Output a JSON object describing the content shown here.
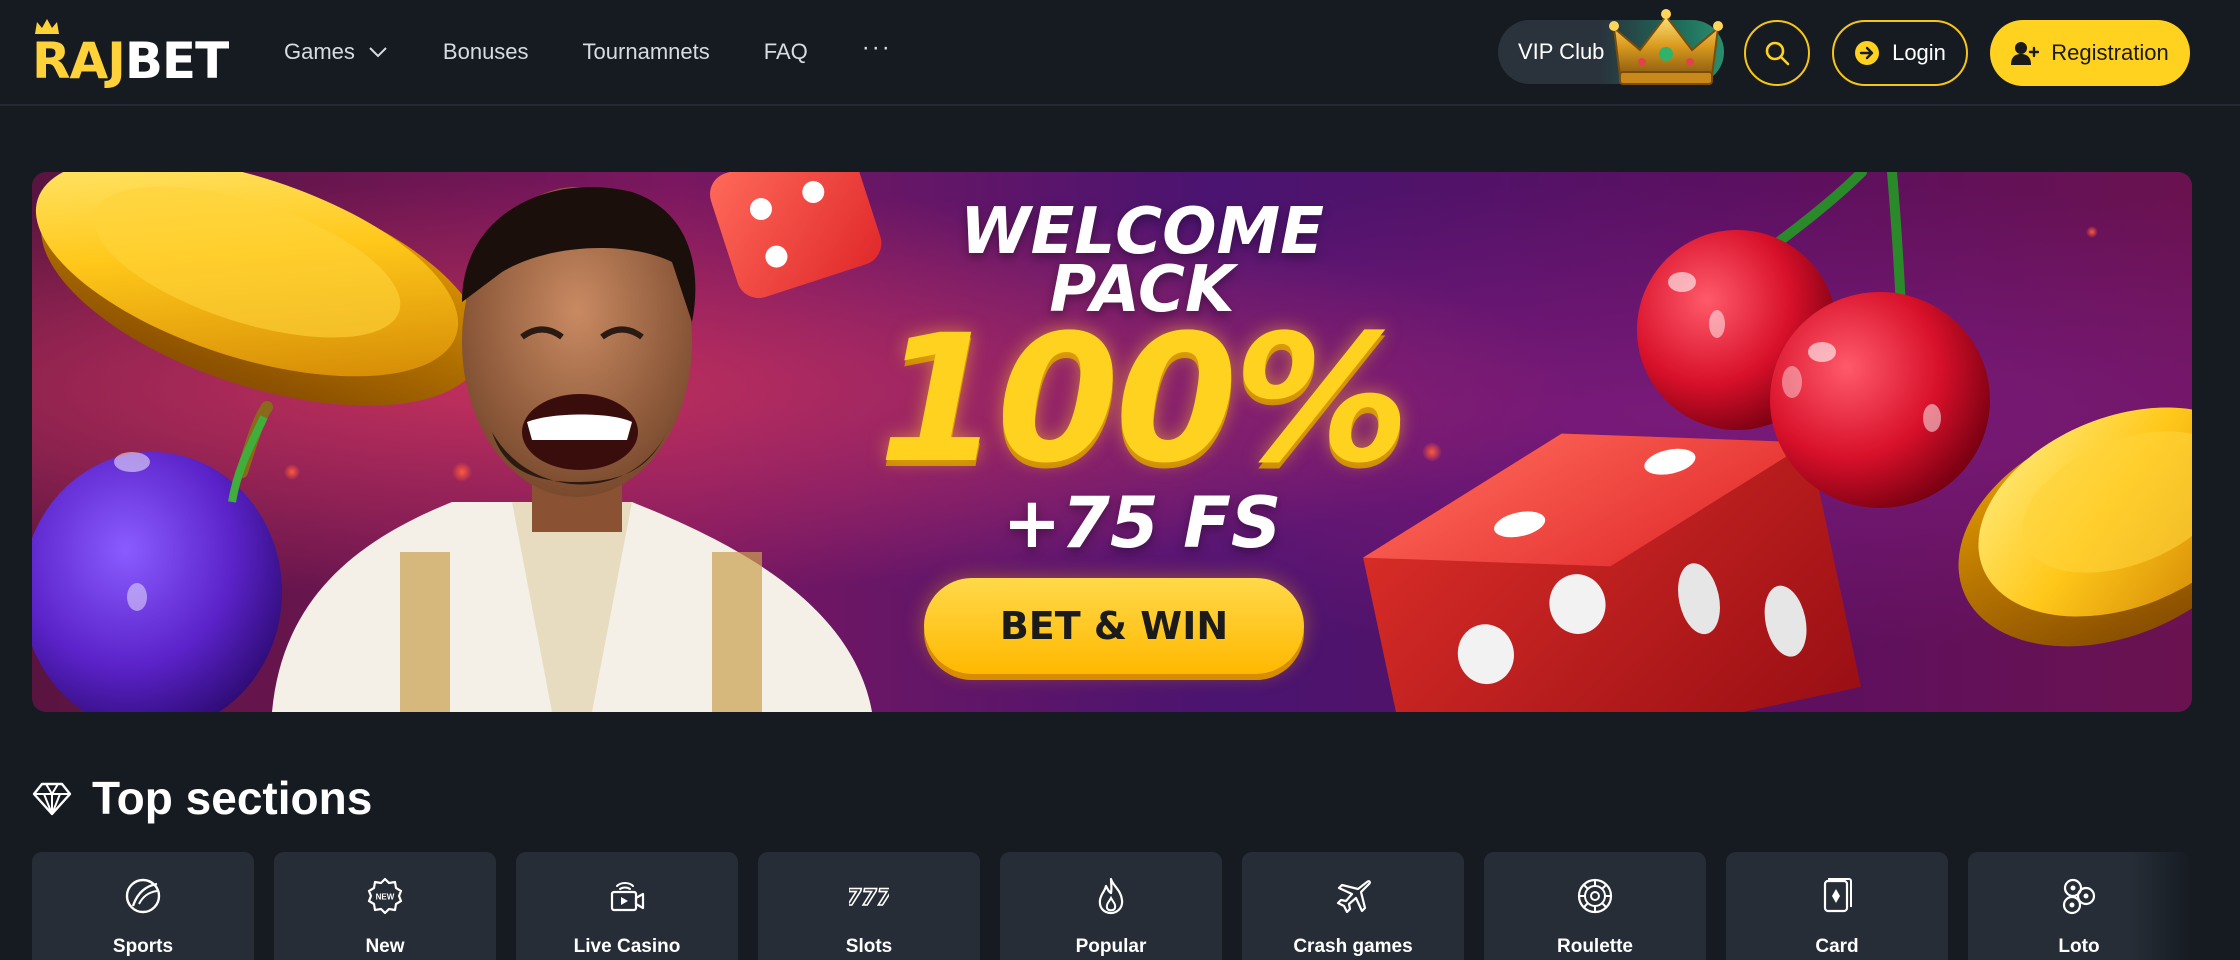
{
  "brand": {
    "part1": "RAJ",
    "part2": "BET",
    "accent": "#ffd21f"
  },
  "nav": [
    {
      "label": "Games",
      "has_dropdown": true
    },
    {
      "label": "Bonuses"
    },
    {
      "label": "Tournamnets"
    },
    {
      "label": "FAQ"
    }
  ],
  "nav_more": "···",
  "header": {
    "vip_label": "VIP Club",
    "login_label": "Login",
    "register_label": "Registration"
  },
  "banner": {
    "title_line1": "WELCOME",
    "title_line2": "PACK",
    "headline": "100%",
    "subline": "+75 FS",
    "cta": "BET & WIN"
  },
  "top_sections": {
    "title": "Top sections",
    "items": [
      {
        "label": "Sports",
        "icon": "sports-ball-icon"
      },
      {
        "label": "New",
        "icon": "new-badge-icon"
      },
      {
        "label": "Live Casino",
        "icon": "live-casino-icon"
      },
      {
        "label": "Slots",
        "icon": "slots-777-icon"
      },
      {
        "label": "Popular",
        "icon": "fire-icon"
      },
      {
        "label": "Crash games",
        "icon": "airplane-icon"
      },
      {
        "label": "Roulette",
        "icon": "roulette-icon"
      },
      {
        "label": "Card",
        "icon": "card-icon"
      },
      {
        "label": "Loto",
        "icon": "loto-balls-icon"
      }
    ]
  },
  "colors": {
    "background": "#161b22",
    "tile": "#262d36",
    "accent_yellow": "#ffd21f"
  }
}
